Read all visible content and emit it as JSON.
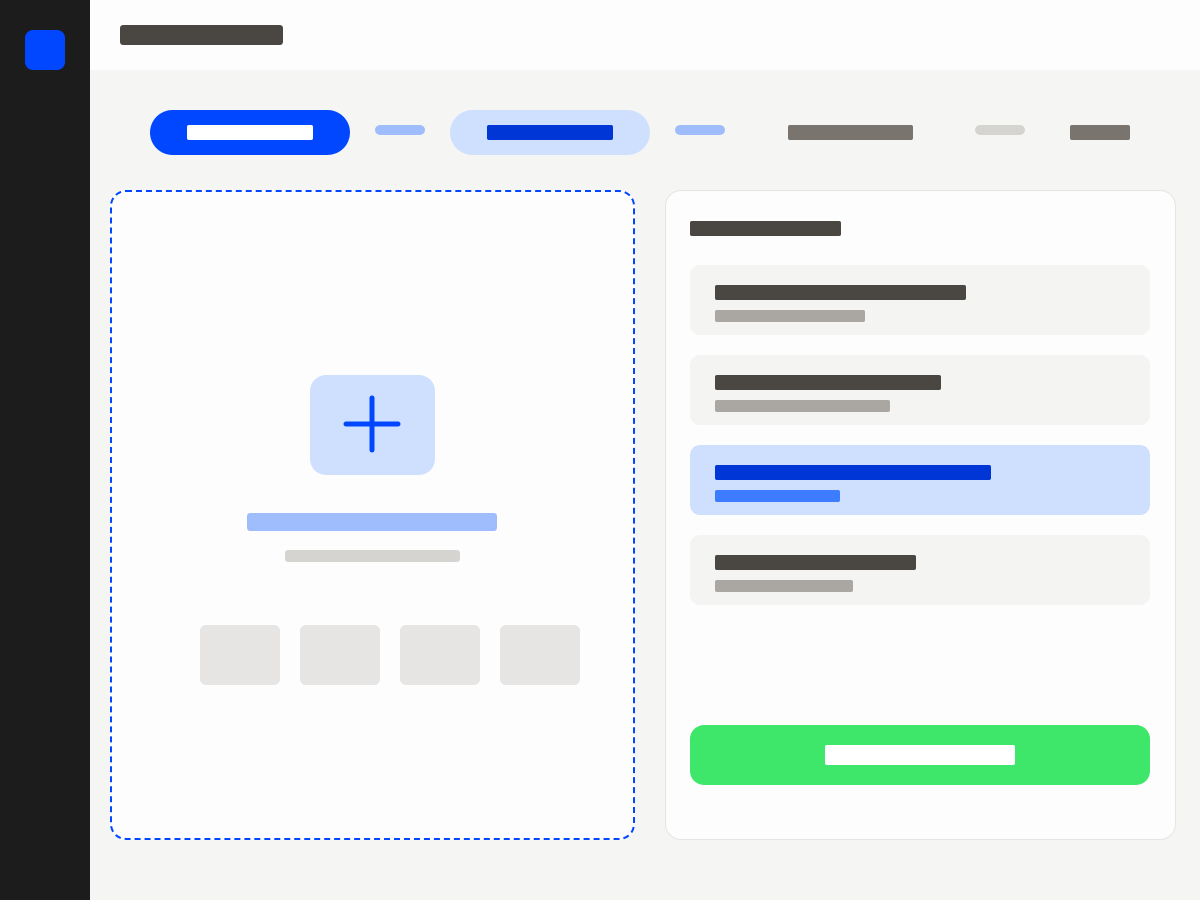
{
  "colors": {
    "sidebar_bg": "#1c1c1c",
    "accent": "#0047ff",
    "accent_light": "#cfe0ff",
    "success": "#3ee66a",
    "page_bg": "#f5f5f4",
    "surface": "#fdfdfd"
  },
  "sidebar": {
    "logo_icon": "app-logo-icon"
  },
  "header": {
    "title_placeholder": "skeleton-text"
  },
  "stepper": {
    "steps": [
      {
        "state": "completed"
      },
      {
        "state": "current"
      },
      {
        "state": "upcoming"
      },
      {
        "state": "upcoming"
      }
    ]
  },
  "upload": {
    "icon": "plus-icon",
    "format_chip_count": 4
  },
  "panel": {
    "item_count": 4,
    "selected_index": 2,
    "primary_action_color": "#3ee66a"
  }
}
